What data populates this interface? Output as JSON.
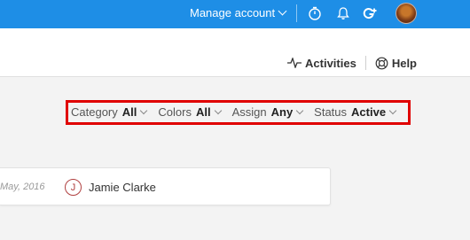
{
  "topbar": {
    "manage_account": "Manage account",
    "icons": [
      "timer-icon",
      "bell-icon",
      "google-plus-icon",
      "avatar"
    ],
    "bg_color": "#1e8ee6"
  },
  "toolbar": {
    "activities_label": "Activities",
    "help_label": "Help"
  },
  "filters": {
    "category": {
      "label": "Category",
      "value": "All"
    },
    "colors": {
      "label": "Colors",
      "value": "All"
    },
    "assign": {
      "label": "Assign",
      "value": "Any"
    },
    "status": {
      "label": "Status",
      "value": "Active"
    },
    "highlight_color": "#e00000"
  },
  "row": {
    "date": "May, 2016",
    "initial": "J",
    "name": "Jamie Clarke"
  }
}
